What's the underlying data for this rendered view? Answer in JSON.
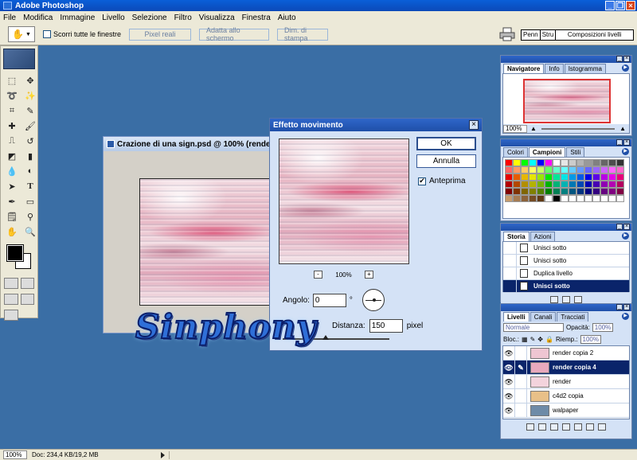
{
  "app": {
    "title": "Adobe Photoshop"
  },
  "menu": [
    "File",
    "Modifica",
    "Immagine",
    "Livello",
    "Selezione",
    "Filtro",
    "Visualizza",
    "Finestra",
    "Aiuto"
  ],
  "options_bar": {
    "scroll_all_label": "Scorri tutte le finestre",
    "scroll_all_checked": false,
    "btn_actual_pixels": "Pixel reali",
    "btn_fit_screen": "Adatta allo schermo",
    "btn_print_size": "Dim. di stampa",
    "palette_well_tabs": [
      "Penn",
      "Stru",
      "Composizioni livelli"
    ]
  },
  "document": {
    "title": "Crazione di una sign.psd @ 100% (render co"
  },
  "dialog": {
    "title": "Effetto movimento",
    "ok_label": "OK",
    "cancel_label": "Annulla",
    "preview_label": "Anteprima",
    "preview_checked": true,
    "zoom_minus": "-",
    "zoom_plus": "+",
    "zoom_value": "100%",
    "angle_label": "Angolo:",
    "angle_value": "0",
    "angle_unit": "°",
    "distance_label": "Distanza:",
    "distance_value": "150",
    "distance_unit": "pixel",
    "distance_fraction": 0.4
  },
  "watermark": "Sinphony",
  "navigator": {
    "tabs": [
      "Navigatore",
      "Info",
      "Istogramma"
    ],
    "zoom": "100%"
  },
  "swatches": {
    "tabs": [
      "Colori",
      "Campioni",
      "Stili"
    ],
    "colors": [
      "#ff0000",
      "#ffff00",
      "#00ff00",
      "#00ffff",
      "#0000ff",
      "#ff00ff",
      "#ffffff",
      "#e6e6e6",
      "#cccccc",
      "#b3b3b3",
      "#999999",
      "#808080",
      "#666666",
      "#4d4d4d",
      "#333333",
      "#ff6666",
      "#ff9966",
      "#ffcc66",
      "#ffff66",
      "#ccff66",
      "#66ff66",
      "#66ffcc",
      "#66ffff",
      "#66ccff",
      "#6699ff",
      "#6666ff",
      "#9966ff",
      "#cc66ff",
      "#ff66ff",
      "#ff66cc",
      "#e60000",
      "#e65c00",
      "#e6b800",
      "#e6e600",
      "#99e600",
      "#00e600",
      "#00e699",
      "#00e6e6",
      "#0099e6",
      "#0059e6",
      "#0000e6",
      "#5c00e6",
      "#b800e6",
      "#e600e6",
      "#e6007a",
      "#b30000",
      "#b34700",
      "#b38f00",
      "#b3b300",
      "#77b300",
      "#00b300",
      "#00b377",
      "#00b3b3",
      "#0077b3",
      "#0047b3",
      "#0000b3",
      "#4700b3",
      "#8f00b3",
      "#b300b3",
      "#b3005f",
      "#800000",
      "#803300",
      "#806600",
      "#808000",
      "#558000",
      "#008000",
      "#008055",
      "#008080",
      "#005580",
      "#003380",
      "#000080",
      "#330080",
      "#660080",
      "#800080",
      "#800044",
      "#c69c6d",
      "#a67c52",
      "#8c6239",
      "#754c24",
      "#603913",
      "#ffffff",
      "#000000",
      "#ffffff",
      "#ffffff",
      "#ffffff",
      "#ffffff",
      "#ffffff",
      "#ffffff",
      "#ffffff",
      "#ffffff"
    ]
  },
  "history": {
    "tabs": [
      "Storia",
      "Azioni"
    ],
    "items": [
      {
        "label": "Unisci sotto",
        "selected": false
      },
      {
        "label": "Unisci sotto",
        "selected": false
      },
      {
        "label": "Duplica livello",
        "selected": false
      },
      {
        "label": "Unisci sotto",
        "selected": true
      }
    ]
  },
  "layers": {
    "tabs": [
      "Livelli",
      "Canali",
      "Tracciati"
    ],
    "blend_mode": "Normale",
    "opacity_label": "Opacità:",
    "opacity_value": "100%",
    "lock_label": "Bloc.:",
    "fill_label": "Riemp.:",
    "fill_value": "100%",
    "items": [
      {
        "name": "render copia 2",
        "selected": false,
        "thumb": "#efc6d2"
      },
      {
        "name": "render copia 4",
        "selected": true,
        "thumb": "#e9a9bd"
      },
      {
        "name": "render",
        "selected": false,
        "thumb": "#f3d3dc"
      },
      {
        "name": "c4d2 copia",
        "selected": false,
        "thumb": "#e8c088"
      },
      {
        "name": "walpaper",
        "selected": false,
        "thumb": "#6e8ba8"
      }
    ]
  },
  "status": {
    "zoom": "100%",
    "doc_info": "Doc: 234,4 KB/19,2 MB"
  }
}
